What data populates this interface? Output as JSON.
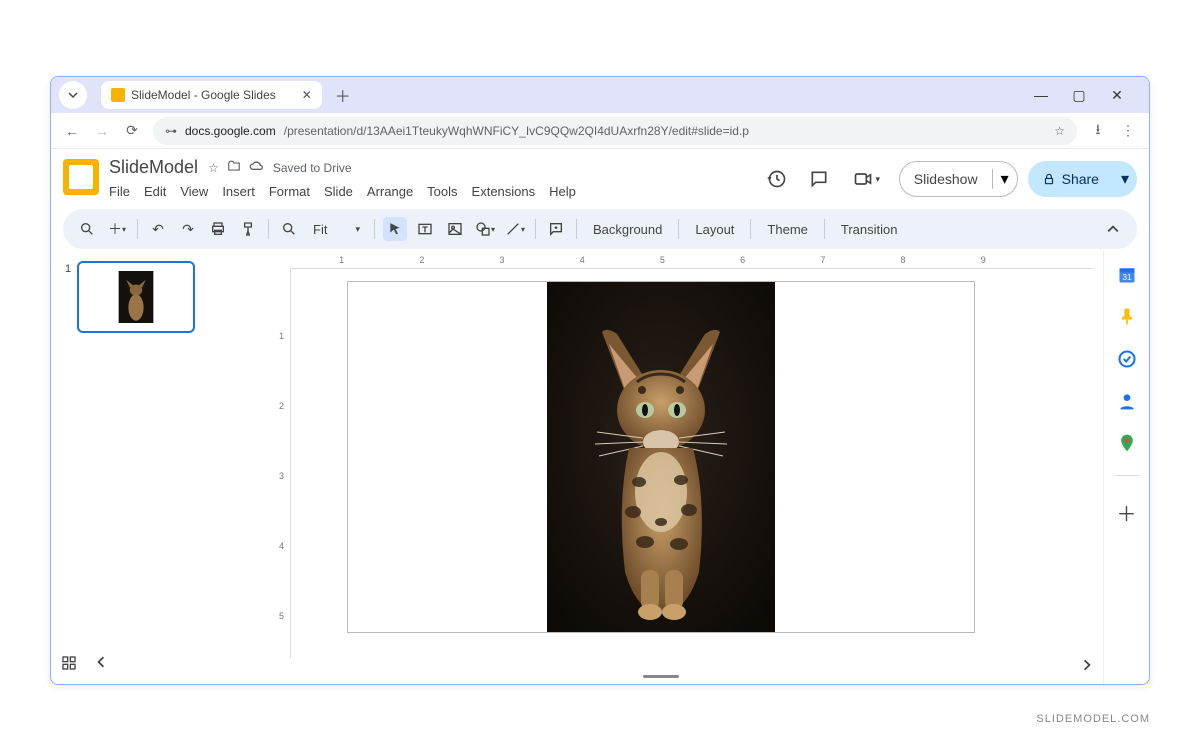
{
  "browser": {
    "tab_title": "SlideModel - Google Slides",
    "url_prefix": "docs.google.com",
    "url_path": "/presentation/d/13AAei1TteukyWqhWNFiCY_IvC9QQw2QI4dUAxrfn28Y/edit#slide=id.p"
  },
  "doc": {
    "title": "SlideModel",
    "saved_text": "Saved to Drive"
  },
  "menubar": [
    "File",
    "Edit",
    "View",
    "Insert",
    "Format",
    "Slide",
    "Arrange",
    "Tools",
    "Extensions",
    "Help"
  ],
  "actions": {
    "slideshow": "Slideshow",
    "share": "Share"
  },
  "toolbar": {
    "fit": "Fit",
    "background": "Background",
    "layout": "Layout",
    "theme": "Theme",
    "transition": "Transition"
  },
  "thumbnails": [
    {
      "number": "1"
    }
  ],
  "ruler_h": [
    "1",
    "2",
    "3",
    "4",
    "5",
    "6",
    "7",
    "8",
    "9"
  ],
  "ruler_v": [
    "1",
    "2",
    "3",
    "4",
    "5"
  ],
  "watermark": "SLIDEMODEL.COM"
}
